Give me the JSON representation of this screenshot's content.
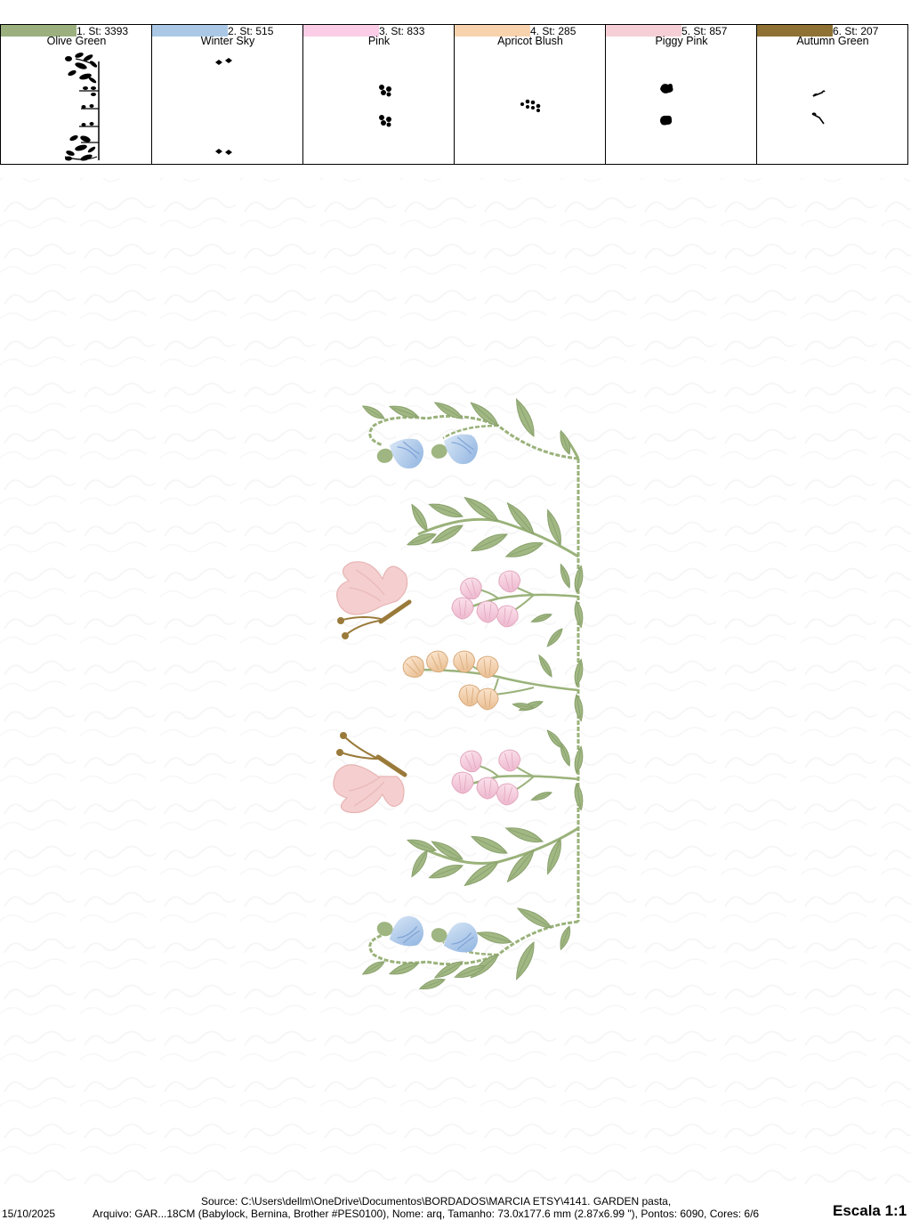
{
  "colors": [
    {
      "label": "1. St: 3393",
      "name": "Olive Green",
      "hex": "#9bb07e"
    },
    {
      "label": "2. St: 515",
      "name": "Winter Sky",
      "hex": "#aac8e6"
    },
    {
      "label": "3. St: 833",
      "name": "Pink",
      "hex": "#fbcde6"
    },
    {
      "label": "4. St: 285",
      "name": "Apricot Blush",
      "hex": "#f8d2ad"
    },
    {
      "label": "5. St: 857",
      "name": "Piggy Pink",
      "hex": "#f6cfd6"
    },
    {
      "label": "6. St: 207",
      "name": "Autumn Green",
      "hex": "#8f7233"
    }
  ],
  "footer": {
    "source": "Source: C:\\Users\\dellm\\OneDrive\\Documentos\\BORDADOS\\MARCIA ETSY\\4141. GARDEN pasta,",
    "date": "15/10/2025",
    "file_info": "Arquivo: GAR...18CM (Babylock, Bernina, Brother #PES0100), Nome: arq, Tamanho: 73.0x177.6 mm (2.87x6.99 \"), Pontos: 6090, Cores: 6/6",
    "scale": "Escala 1:1"
  },
  "design": {
    "stem_color": "#9ab27a",
    "leaf_color": "#9fb582",
    "leaf_dark": "#7f9a62",
    "blue": "#a9c5e8",
    "pink": "#f6c9da",
    "apricot": "#f2d1ae",
    "butterfly": "#f5cfcf",
    "brown": "#9a7a3a"
  }
}
